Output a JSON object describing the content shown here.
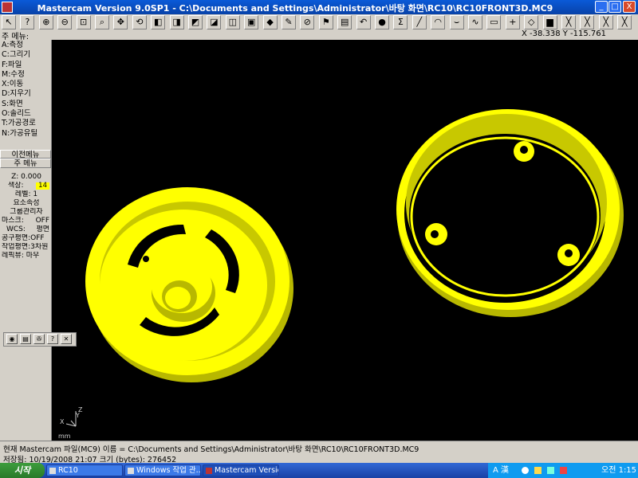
{
  "window": {
    "title": "Mastercam Version 9.0SP1 - C:\\Documents and Settings\\Administrator\\바탕 화면\\RC10\\RC10FRONT3D.MC9",
    "min": "_",
    "max": "□",
    "close": "X"
  },
  "toolbar": {
    "icons": [
      "pointer-icon",
      "help-icon",
      "zoom-in-icon",
      "zoom-out-icon",
      "zoom-fit-icon",
      "zoom-window-icon",
      "move-icon",
      "rotate-icon",
      "cube-top-icon",
      "cube-front-icon",
      "cube-side-icon",
      "cube-iso-icon",
      "cube-view-icon",
      "cube-wire-icon",
      "cube-shade-icon",
      "pen-icon",
      "no-entry-icon",
      "flag-icon",
      "attributes-icon",
      "undo-icon",
      "sphere-icon",
      "sigma-icon",
      "line-icon",
      "arc-icon",
      "curve-icon",
      "spline-icon",
      "rectangle-icon",
      "plus-icon",
      "diamond-icon",
      "folder-icon",
      "close-x-icon",
      "close-x-icon",
      "close-x-icon",
      "close-x-icon"
    ],
    "glyphs": [
      "↖",
      "?",
      "⊕",
      "⊖",
      "⊡",
      "⌕",
      "✥",
      "⟲",
      "◧",
      "◨",
      "◩",
      "◪",
      "◫",
      "▣",
      "◆",
      "✎",
      "⊘",
      "⚑",
      "▤",
      "↶",
      "●",
      "Σ",
      "╱",
      "◠",
      "⌣",
      "∿",
      "▭",
      "+",
      "◇",
      "▆",
      "╳",
      "╳",
      "╳",
      "╳"
    ]
  },
  "coords": {
    "menu_label": "주 메뉴:",
    "readout": "X -38.338  Y -115.761"
  },
  "main_menu": [
    "A:측정",
    "C:그리기",
    "F:파일",
    "M:수정",
    "X:이동",
    "D:지우기",
    "S:화면",
    "O:솔리드",
    "T:가공경로",
    "N:가공유틸"
  ],
  "nav": {
    "prev": "이전메뉴",
    "main": "주 메뉴"
  },
  "settings": {
    "z_label": "Z:",
    "z_value": "0.000",
    "color_label": "색상:",
    "color_value": "14",
    "level_label": "레벨:",
    "level_value": "1",
    "attr": "요소속성",
    "group": "그룹관리자",
    "mask_label": "마스크:",
    "mask_value": "OFF",
    "wcs_label": "WCS:",
    "wcs_value": "평면",
    "tplane_label": "공구평면:",
    "tplane_value": "OFF",
    "cplane_label": "작업평면:",
    "cplane_value": "3차원",
    "gview_label": "레픽뷰:",
    "gview_value": "마우"
  },
  "mini_toolbar": [
    "record-icon",
    "save-icon",
    "wrench-icon",
    "help-icon",
    "close-icon"
  ],
  "mini_glyphs": [
    "◉",
    "▤",
    "✇",
    "?",
    "✕"
  ],
  "axes": {
    "x": "X",
    "y": "Y",
    "z": "Z",
    "mm": "mm"
  },
  "status": {
    "line1": "현재 Mastercam 파일(MC9) 이름 = C:\\Documents and Settings\\Administrator\\바탕 화면\\RC10\\RC10FRONT3D.MC9",
    "line2": "저장됨: 10/19/2008 21:07  크기 (bytes):      276452"
  },
  "taskbar": {
    "start": "시작",
    "tasks": [
      {
        "label": "RC10"
      },
      {
        "label": "Windows 작업 관..."
      },
      {
        "label": "Mastercam Versio..."
      }
    ],
    "tray_lang": "A 漢",
    "clock": "오전 1:15"
  },
  "colors": {
    "part": "#ffff00",
    "shadow": "#b8b800",
    "viewport": "#000000"
  }
}
